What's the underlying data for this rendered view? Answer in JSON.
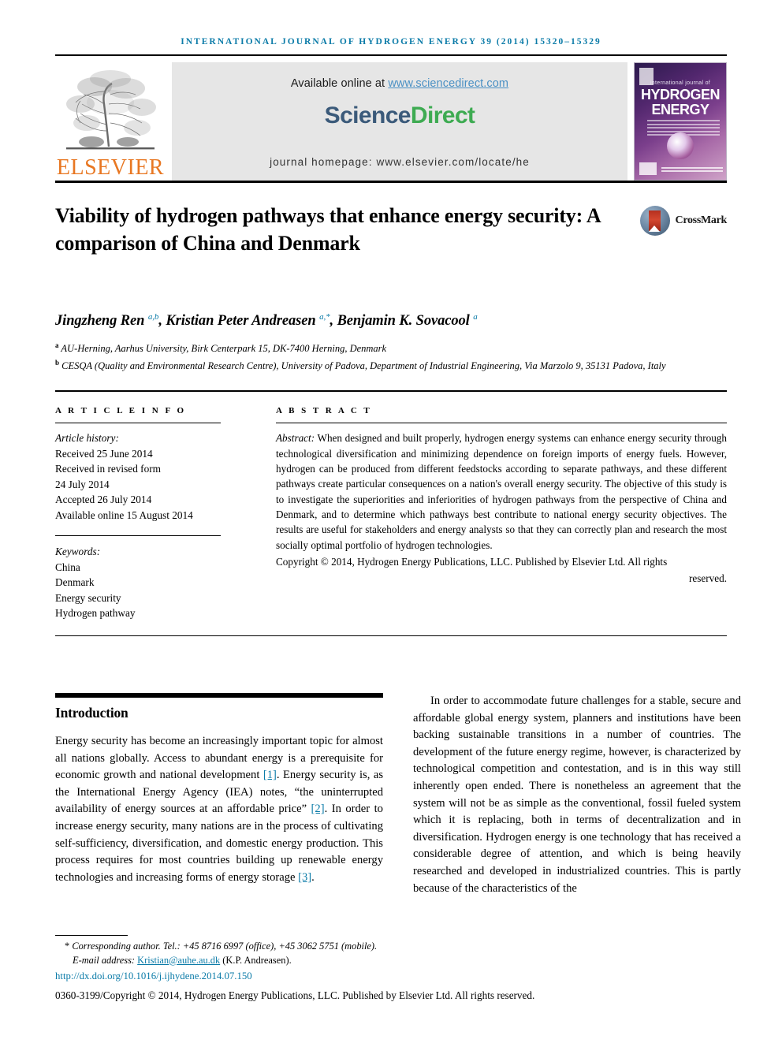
{
  "running_head": "International Journal of Hydrogen Energy 39 (2014) 15320–15329",
  "masthead": {
    "publisher_name": "ELSEVIER",
    "available_prefix": "Available online at ",
    "available_url": "www.sciencedirect.com",
    "sciencedirect_part1": "Science",
    "sciencedirect_part2": "Direct",
    "journal_homepage": "journal homepage: www.elsevier.com/locate/he",
    "cover": {
      "line_small": "international journal of",
      "line_1": "HYDROGEN",
      "line_2": "ENERGY"
    }
  },
  "article": {
    "title": "Viability of hydrogen pathways that enhance energy security: A comparison of China and Denmark",
    "crossmark_label": "CrossMark",
    "authors_html": "Jingzheng Ren <sup>a,b</sup>, Kristian Peter Andreasen <sup>a,*</sup>, Benjamin K. Sovacool <sup>a</sup>",
    "affiliations": [
      {
        "marker": "a",
        "text": "AU-Herning, Aarhus University, Birk Centerpark 15, DK-7400 Herning, Denmark"
      },
      {
        "marker": "b",
        "text": "CESQA (Quality and Environmental Research Centre), University of Padova, Department of Industrial Engineering, Via Marzolo 9, 35131 Padova, Italy"
      }
    ]
  },
  "article_info": {
    "heading": "A R T I C L E   I N F O",
    "history_label": "Article history:",
    "history": [
      "Received 25 June 2014",
      "Received in revised form",
      "24 July 2014",
      "Accepted 26 July 2014",
      "Available online 15 August 2014"
    ],
    "keywords_label": "Keywords:",
    "keywords": [
      "China",
      "Denmark",
      "Energy security",
      "Hydrogen pathway"
    ]
  },
  "abstract_section": {
    "heading": "A B S T R A C T",
    "lead": "Abstract:",
    "body": " When designed and built properly, hydrogen energy systems can enhance energy security through technological diversification and minimizing dependence on foreign imports of energy fuels. However, hydrogen can be produced from different feedstocks according to separate pathways, and these different pathways create particular consequences on a nation's overall energy security. The objective of this study is to investigate the superiorities and inferiorities of hydrogen pathways from the perspective of China and Denmark, and to determine which pathways best contribute to national energy security objectives. The results are useful for stakeholders and energy analysts so that they can correctly plan and research the most socially optimal portfolio of hydrogen technologies.",
    "copyright": "Copyright © 2014, Hydrogen Energy Publications, LLC. Published by Elsevier Ltd. All rights",
    "copyright_end": "reserved."
  },
  "introduction": {
    "heading": "Introduction",
    "left_paragraph_parts": [
      "Energy security has become an increasingly important topic for almost all nations globally. Access to abundant energy is a prerequisite for economic growth and national development ",
      "[1]",
      ". Energy security is, as the International Energy Agency (IEA) notes, “the uninterrupted availability of energy sources at an affordable price” ",
      "[2]",
      ". In order to increase energy security, many nations are in the process of cultivating self-sufficiency, diversification, and domestic energy production. This process requires for most countries building up renewable energy technologies and increasing forms of energy storage ",
      "[3]",
      "."
    ],
    "right_paragraph": "In order to accommodate future challenges for a stable, secure and affordable global energy system, planners and institutions have been backing sustainable transitions in a number of countries. The development of the future energy regime, however, is characterized by technological competition and contestation, and is in this way still inherently open ended. There is nonetheless an agreement that the system will not be as simple as the conventional, fossil fueled system which it is replacing, both in terms of decentralization and in diversification. Hydrogen energy is one technology that has received a considerable degree of attention, and which is being heavily researched and developed in industrialized countries. This is partly because of the characteristics of the"
  },
  "footer": {
    "corresponding_star": "*",
    "corresponding_text": "Corresponding author. Tel.: +45 8716 6997 (office), +45 3062 5751 (mobile).",
    "email_label": "E-mail address:",
    "email": "Kristian@auhe.au.dk",
    "email_attribution": "(K.P. Andreasen).",
    "doi": "http://dx.doi.org/10.1016/j.ijhydene.2014.07.150",
    "issn_copyright": "0360-3199/Copyright © 2014, Hydrogen Energy Publications, LLC. Published by Elsevier Ltd. All rights reserved."
  },
  "colors": {
    "link_blue": "#0b7ba8",
    "elsevier_orange": "#E87722",
    "sciencedirect_green": "#3eab52",
    "sciencedirect_navy": "#3b5a7a"
  }
}
